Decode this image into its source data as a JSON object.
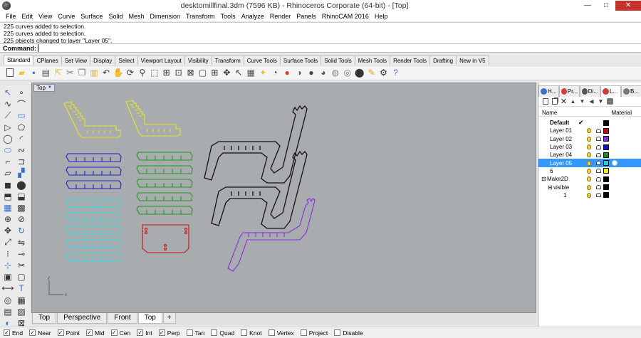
{
  "window": {
    "title": "desktomillfinal.3dm (7596 KB) - Rhinoceros Corporate (64-bit) - [Top]",
    "minimize": "—",
    "maximize": "□",
    "close": "✕"
  },
  "menu": [
    "File",
    "Edit",
    "View",
    "Curve",
    "Surface",
    "Solid",
    "Mesh",
    "Dimension",
    "Transform",
    "Tools",
    "Analyze",
    "Render",
    "Panels",
    "RhinoCAM 2016",
    "Help"
  ],
  "command_history": [
    "225 curves added to selection.",
    "225 curves added to selection.",
    "225 objects changed to layer \"Layer 05\"."
  ],
  "command": {
    "label": "Command:",
    "value": ""
  },
  "toolbar_tabs": [
    "Standard",
    "CPlanes",
    "Set View",
    "Display",
    "Select",
    "Viewport Layout",
    "Visibility",
    "Transform",
    "Curve Tools",
    "Surface Tools",
    "Solid Tools",
    "Mesh Tools",
    "Render Tools",
    "Drafting",
    "New in V5"
  ],
  "toolbar_tabs_active": "Standard",
  "toolbar_icons": [
    "new-icon",
    "open-icon",
    "save-icon",
    "print-icon",
    "import-icon",
    "cut-icon",
    "copy-icon",
    "paste-icon",
    "undo-icon",
    "pan-icon",
    "rotate-view-icon",
    "zoom-dynamic-icon",
    "zoom-window-icon",
    "zoom-extents-icon",
    "zoom-selected-icon",
    "zoom-all-icon",
    "viewport-maximize-icon",
    "four-view-icon",
    "cplane-icon",
    "select-icon",
    "layer-icon",
    "light-icon",
    "properties-icon",
    "material-icon",
    "render-icon",
    "shade-icon",
    "rendered-icon",
    "ghosted-icon",
    "xray-icon",
    "material-editor-icon",
    "snapshot-icon",
    "options-icon",
    "help-icon"
  ],
  "left_icons": [
    "select-points-icon",
    "point-icon",
    "polyline-icon",
    "curve-icon",
    "line-icon",
    "rectangle-icon",
    "triangle-icon",
    "polygon-icon",
    "circle-icon",
    "arc-icon",
    "ellipse-icon",
    "freeform-icon",
    "fillet-icon",
    "offset-icon",
    "surface-icon",
    "patch-icon",
    "box-icon",
    "sphere-icon",
    "extrude-icon",
    "loft-icon",
    "mesh-icon",
    "mesh-box-icon",
    "boolean-icon",
    "split-icon",
    "move-icon",
    "rotate-icon",
    "scale-icon",
    "mirror-icon",
    "array-icon",
    "join-icon",
    "explode-icon",
    "trim-icon",
    "group-icon",
    "ungroup-icon",
    "dimension-icon",
    "text-icon",
    "osnap-icon",
    "grid-icon",
    "block-icon",
    "array-polar-icon",
    "hide-icon",
    "lock-icon"
  ],
  "viewport": {
    "title": "Top",
    "axis_x": "x",
    "axis_y": "y"
  },
  "viewport_tabs": [
    "Top",
    "Perspective",
    "Front",
    "Top"
  ],
  "viewport_tabs_active": 3,
  "add_tab": "+",
  "osnaps": [
    {
      "label": "End",
      "checked": true
    },
    {
      "label": "Near",
      "checked": true
    },
    {
      "label": "Point",
      "checked": true
    },
    {
      "label": "Mid",
      "checked": true
    },
    {
      "label": "Cen",
      "checked": true
    },
    {
      "label": "Int",
      "checked": true
    },
    {
      "label": "Perp",
      "checked": true
    },
    {
      "label": "Tan",
      "checked": false
    },
    {
      "label": "Quad",
      "checked": false
    },
    {
      "label": "Knot",
      "checked": false
    },
    {
      "label": "Vertex",
      "checked": false
    },
    {
      "label": "Project",
      "checked": false
    },
    {
      "label": "Disable",
      "checked": false
    }
  ],
  "panel": {
    "tabs": [
      {
        "label": "H...",
        "icon": "help-icon",
        "color": "#3a6fcf"
      },
      {
        "label": "Pr...",
        "icon": "properties-icon",
        "color": "#d93b3b"
      },
      {
        "label": "Di...",
        "icon": "display-icon",
        "color": "#555555"
      },
      {
        "label": "L...",
        "icon": "layers-icon",
        "color": "#cf3a3a"
      },
      {
        "label": "B...",
        "icon": "blocks-icon",
        "color": "#777777"
      }
    ],
    "active_tab": 3,
    "header_name": "Name",
    "header_material": "Material",
    "layers": [
      {
        "name": "Default",
        "indent": 0,
        "bold": true,
        "current": true,
        "color": "#000000",
        "selected": false,
        "expander": "",
        "show_icons": false
      },
      {
        "name": "Layer 01",
        "indent": 0,
        "bold": false,
        "current": false,
        "color": "#cc0000",
        "selected": false,
        "expander": "",
        "show_icons": true
      },
      {
        "name": "Layer 02",
        "indent": 0,
        "bold": false,
        "current": false,
        "color": "#8a2be2",
        "selected": false,
        "expander": "",
        "show_icons": true
      },
      {
        "name": "Layer 03",
        "indent": 0,
        "bold": false,
        "current": false,
        "color": "#1010cc",
        "selected": false,
        "expander": "",
        "show_icons": true
      },
      {
        "name": "Layer 04",
        "indent": 0,
        "bold": false,
        "current": false,
        "color": "#1a8a1a",
        "selected": false,
        "expander": "",
        "show_icons": true
      },
      {
        "name": "Layer 05",
        "indent": 0,
        "bold": false,
        "current": false,
        "color": "#27d3d3",
        "selected": true,
        "expander": "",
        "show_icons": true
      },
      {
        "name": "6",
        "indent": 0,
        "bold": false,
        "current": false,
        "color": "#f0f000",
        "selected": false,
        "expander": "",
        "show_icons": true
      },
      {
        "name": "Make2D",
        "indent": 0,
        "bold": false,
        "current": false,
        "color": "#000000",
        "selected": false,
        "expander": "⊟",
        "show_icons": true
      },
      {
        "name": "visible",
        "indent": 1,
        "bold": false,
        "current": false,
        "color": "#000000",
        "selected": false,
        "expander": "⊟",
        "show_icons": true
      },
      {
        "name": "1",
        "indent": 2,
        "bold": false,
        "current": false,
        "color": "#000000",
        "selected": false,
        "expander": "",
        "show_icons": true
      }
    ]
  }
}
